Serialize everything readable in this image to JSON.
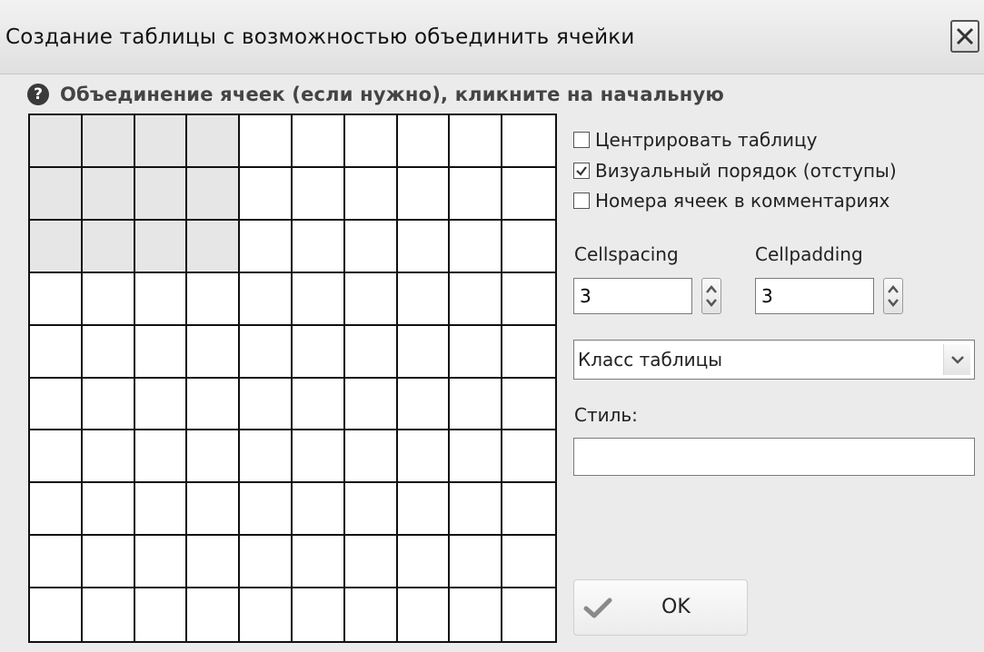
{
  "window": {
    "title": "Создание таблицы с возможностью объединить ячейки"
  },
  "header": {
    "help_icon": "question-circle-icon",
    "text": "Объединение ячеек (если нужно), кликните на начальную"
  },
  "grid": {
    "rows": 10,
    "cols": 10,
    "selected_rows": 3,
    "selected_cols": 4
  },
  "options": [
    {
      "label": "Центрировать таблицу",
      "checked": false
    },
    {
      "label": "Визуальный порядок (отступы)",
      "checked": true
    },
    {
      "label": "Номера ячеек в комментариях",
      "checked": false
    }
  ],
  "cellspacing": {
    "label": "Cellspacing",
    "value": "3"
  },
  "cellpadding": {
    "label": "Cellpadding",
    "value": "3"
  },
  "table_class": {
    "selected": "Класс таблицы"
  },
  "style": {
    "label": "Стиль:",
    "value": ""
  },
  "ok_button": {
    "label": "OK",
    "icon": "checkmark-icon"
  }
}
